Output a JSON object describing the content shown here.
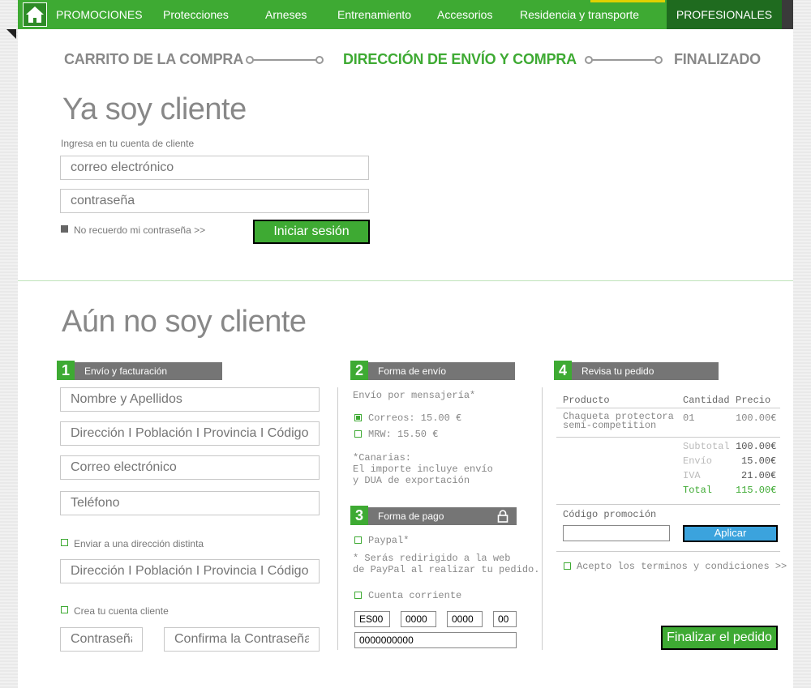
{
  "nav": {
    "items": [
      {
        "label": "PROMOCIONES"
      },
      {
        "label": "Protecciones"
      },
      {
        "label": "Arneses"
      },
      {
        "label": "Entrenamiento"
      },
      {
        "label": "Accesorios"
      },
      {
        "label": "Residencia y transporte"
      }
    ],
    "pro_label": "PROFESIONALES"
  },
  "steps": {
    "cart": "CARRITO DE LA COMPRA",
    "shipping": "DIRECCIÓN DE ENVÍO Y COMPRA",
    "done": "FINALIZADO"
  },
  "login": {
    "title": "Ya soy cliente",
    "subtitle": "Ingresa en tu cuenta de cliente",
    "email_placeholder": "correo electrónico",
    "password_placeholder": "contraseña",
    "forgot": "No recuerdo mi contraseña >>",
    "submit": "Iniciar sesión"
  },
  "register": {
    "title": "Aún no soy cliente",
    "section1": {
      "num": "1",
      "title": "Envío y facturación",
      "name_ph": "Nombre y Apellidos",
      "address_ph": "Dirección I Población I Provincia I Código Postal",
      "email_ph": "Correo electrónico",
      "phone_ph": "Teléfono",
      "alt_address_label": "Enviar a una dirección distinta",
      "alt_address_ph": "Dirección I Población I Provincia I Código Postal",
      "create_account_label": "Crea tu cuenta cliente",
      "password_ph": "Contraseña",
      "confirm_ph": "Confirma la Contraseña"
    },
    "section2": {
      "num": "2",
      "title": "Forma de envío",
      "intro": "Envío por mensajería*",
      "options": [
        {
          "label": "Correos: 15.00 €",
          "checked": true
        },
        {
          "label": "MRW: 15.50 €",
          "checked": false
        }
      ],
      "note": [
        "*Canarias:",
        "El importe incluye envío",
        "y DUA de exportación"
      ]
    },
    "section3": {
      "num": "3",
      "title": "Forma de pago",
      "paypal_label": "Paypal*",
      "paypal_note": [
        "* Serás redirigido a la web",
        "de PayPal al realizar tu pedido."
      ],
      "account_label": "Cuenta corriente",
      "account": {
        "iban": "ES00",
        "entity": "0000",
        "office": "0000",
        "dc": "00",
        "number": "0000000000"
      }
    },
    "section4": {
      "num": "4",
      "title": "Revisa tu pedido",
      "columns": {
        "product": "Producto",
        "qty": "Cantidad",
        "price": "Precio"
      },
      "item": {
        "name": [
          "Chaqueta protectora",
          "semi-competition"
        ],
        "qty": "01",
        "price": "100.00€"
      },
      "subtotal": {
        "label": "Subtotal",
        "value": "100.00€"
      },
      "shipping": {
        "label": "Envío",
        "value": "15.00€"
      },
      "tax": {
        "label": "IVA",
        "value": "21.00€"
      },
      "total": {
        "label": "Total",
        "value": "115.00€"
      },
      "promo_label": "Código promoción",
      "apply": "Aplicar",
      "terms": "Acepto los terminos y condiciones >>",
      "finish": "Finalizar el pedido"
    }
  }
}
